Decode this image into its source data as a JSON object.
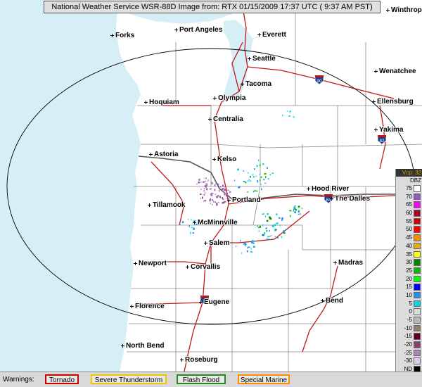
{
  "title": "National Weather Service WSR-88D Image from: RTX 01/15/2009 17:37 UTC ( 9:37 AM PST)",
  "cities": [
    {
      "name": "Forks"
    },
    {
      "name": "Port Angeles"
    },
    {
      "name": "Everett"
    },
    {
      "name": "Seattle"
    },
    {
      "name": "Tacoma"
    },
    {
      "name": "Olympia"
    },
    {
      "name": "Hoquiam"
    },
    {
      "name": "Centralia"
    },
    {
      "name": "Astoria"
    },
    {
      "name": "Kelso"
    },
    {
      "name": "Tillamook"
    },
    {
      "name": "Portland"
    },
    {
      "name": "Hood River"
    },
    {
      "name": "The Dalles"
    },
    {
      "name": "McMinnville"
    },
    {
      "name": "Salem"
    },
    {
      "name": "Newport"
    },
    {
      "name": "Corvallis"
    },
    {
      "name": "Madras"
    },
    {
      "name": "Florence"
    },
    {
      "name": "Eugene"
    },
    {
      "name": "Bend"
    },
    {
      "name": "North Bend"
    },
    {
      "name": "Roseburg"
    },
    {
      "name": "Winthrop"
    },
    {
      "name": "Wenatchee"
    },
    {
      "name": "Ellensburg"
    },
    {
      "name": "Yakima"
    }
  ],
  "interstate_shields": [
    "5",
    "90",
    "82",
    "84"
  ],
  "scale": {
    "vcp_label": "Vcp: 32",
    "unit": "DBZ",
    "levels": [
      {
        "label": "75",
        "color": "#ffffff"
      },
      {
        "label": "70",
        "color": "#9a55c8"
      },
      {
        "label": "65",
        "color": "#ff00ff"
      },
      {
        "label": "60",
        "color": "#b0002a"
      },
      {
        "label": "55",
        "color": "#d40000"
      },
      {
        "label": "50",
        "color": "#ff0000"
      },
      {
        "label": "45",
        "color": "#ff8c00"
      },
      {
        "label": "40",
        "color": "#e8b000"
      },
      {
        "label": "35",
        "color": "#ffff00"
      },
      {
        "label": "30",
        "color": "#008800"
      },
      {
        "label": "25",
        "color": "#00bb00"
      },
      {
        "label": "20",
        "color": "#00ff00"
      },
      {
        "label": "15",
        "color": "#0000ff"
      },
      {
        "label": "10",
        "color": "#1e90ff"
      },
      {
        "label": "5",
        "color": "#00d8e8"
      },
      {
        "label": "0",
        "color": "#dcdcdc"
      },
      {
        "label": "-5",
        "color": "#b8b8b8"
      },
      {
        "label": "-10",
        "color": "#908070"
      },
      {
        "label": "-15",
        "color": "#600020"
      },
      {
        "label": "-20",
        "color": "#8a3f6e"
      },
      {
        "label": "-25",
        "color": "#b080b8"
      },
      {
        "label": "-30",
        "color": "#e0c8e8"
      },
      {
        "label": "ND",
        "color": "#000000"
      }
    ]
  },
  "warnings": {
    "label": "Warnings:",
    "items": [
      {
        "label": "Tornado",
        "color": "#cc0000"
      },
      {
        "label": "Severe Thunderstorm",
        "color": "#e8c800"
      },
      {
        "label": "Flash Flood",
        "color": "#228b22"
      },
      {
        "label": "Special Marine",
        "color": "#ff8c00"
      }
    ]
  },
  "colors": {
    "ocean": "#d6eef6",
    "land": "#ffffff",
    "border": "#888888",
    "highway": "#c01818",
    "range_ring": "#000000"
  }
}
